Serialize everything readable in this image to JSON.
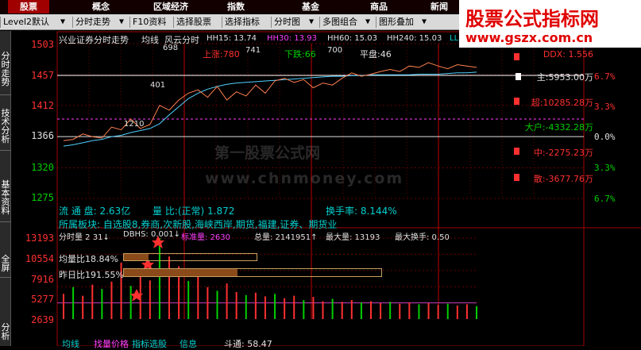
{
  "top_nav": {
    "tabs": [
      "股票",
      "概念",
      "区域经济",
      "指数",
      "基金",
      "商品",
      "新闻"
    ],
    "active": 0
  },
  "toolbar": {
    "level2": "Level2默认",
    "intraday": "分时走势",
    "f10": "F10资料",
    "select_stock": "选择股票",
    "select_indicator": "选择指标",
    "intraday_chart": "分时图",
    "multi_chart": "多图组合",
    "overlay": "图形叠加"
  },
  "side_tabs": [
    "分时走势",
    "技术分析",
    "基本资料",
    "全屏",
    "分析"
  ],
  "watermark": {
    "brand": "股票公式指标网",
    "url": "www.gszx.com.cn",
    "center_1": "第一股票公式网",
    "center_2": "www.chnmoney.com"
  },
  "chart_header": {
    "title": "兴业证券分时走势",
    "avg_line": "均线",
    "feng_yun": "风云分时",
    "hh15": "HH15: 13.74",
    "hh30": "HH30: 13.93",
    "hh60": "HH60: 15.03",
    "hh240": "HH240: 15.03",
    "ll": "LL"
  },
  "price_axis": [
    "1503",
    "1457",
    "1412",
    "1366",
    "1320",
    "1275"
  ],
  "volume_axis": [
    "13193",
    "10554",
    "7916",
    "5277",
    "2639"
  ],
  "percent_axis": [
    "6.7%",
    "3.3%",
    "0.0%",
    "3.3%",
    "6.7%"
  ],
  "breadth": {
    "up_label": "上涨:780",
    "down_label": "下跌:66",
    "flat_label": "平盘:46"
  },
  "point_labels": {
    "p698": "698",
    "p741": "741",
    "p700": "700",
    "p401": "401",
    "p1210": "1210"
  },
  "money_flow": {
    "ddx": "DDX: 1.556",
    "main": "主:5953.00万",
    "super": "超:10285.28万",
    "retail": "大户:-4332.28万",
    "mid": "中:-2275.23万",
    "small": "散:-3677.76万"
  },
  "stock_info": {
    "float_share": "流 通 盘: 2.63亿",
    "vol_ratio": "量 比:(正常) 1.872",
    "turnover": "换手率: 8.144%",
    "sectors": "所属板块: 自选股8,券商,次新股,海峡西岸,期货,福建,证券、期货业"
  },
  "volume_header": {
    "label": "分时量 2 31↓",
    "dbhs": "DBHS: 0.001↓",
    "std": "标准量: 2630",
    "total": "总量: 2141951↑",
    "max_vol": "最大量: 13193",
    "max_turn": "最大换手: 0.50"
  },
  "ratios": {
    "avg_ratio": "均量比18.84%",
    "prev_ratio": "昨日比191.55%"
  },
  "bottom_tabs": {
    "tab1": "均线",
    "tab2": "找量价格",
    "tab3": "指标选股",
    "tab4": "信息",
    "tab5": "斗通: 58.47"
  },
  "chart_data": {
    "type": "line",
    "price_range": [
      1275,
      1503
    ],
    "prev_close": 1366,
    "series": [
      {
        "name": "均线",
        "color": "#50d0ff",
        "values": [
          1352,
          1354,
          1357,
          1360,
          1362,
          1366,
          1368,
          1372,
          1375,
          1378,
          1385,
          1398,
          1410,
          1422,
          1430,
          1436,
          1440,
          1443,
          1445,
          1446,
          1447,
          1448,
          1449,
          1450,
          1451,
          1452,
          1453,
          1454,
          1455,
          1455,
          1456,
          1456,
          1457,
          1457,
          1457,
          1457,
          1457,
          1458,
          1458,
          1458,
          1459,
          1460,
          1460,
          1461
        ]
      },
      {
        "name": "价格",
        "color": "#ff8050",
        "values": [
          1360,
          1362,
          1370,
          1366,
          1364,
          1380,
          1376,
          1392,
          1378,
          1384,
          1412,
          1405,
          1420,
          1430,
          1435,
          1424,
          1440,
          1420,
          1432,
          1426,
          1442,
          1430,
          1448,
          1452,
          1446,
          1450,
          1438,
          1445,
          1442,
          1452,
          1460,
          1455,
          1458,
          1462,
          1465,
          1462,
          1470,
          1468,
          1475,
          1470,
          1466,
          1472,
          1470,
          1468
        ]
      }
    ],
    "volume": [
      4100,
      5200,
      3800,
      5600,
      4900,
      6100,
      9200,
      5400,
      7700,
      6300,
      13193,
      10200,
      8600,
      6200,
      7900,
      5200,
      4600,
      5800,
      4400,
      3900,
      4300,
      3700,
      4100,
      3400,
      3800,
      3100,
      3600,
      2900,
      3300,
      2800,
      3100,
      2700,
      2900,
      2600,
      2800,
      2500,
      2700,
      2400,
      2600,
      2300,
      2500,
      2200,
      2400,
      2100
    ],
    "volume_max": 13193,
    "avg_ratio_fraction": 0.188,
    "prev_ratio_fraction": 0.44
  }
}
